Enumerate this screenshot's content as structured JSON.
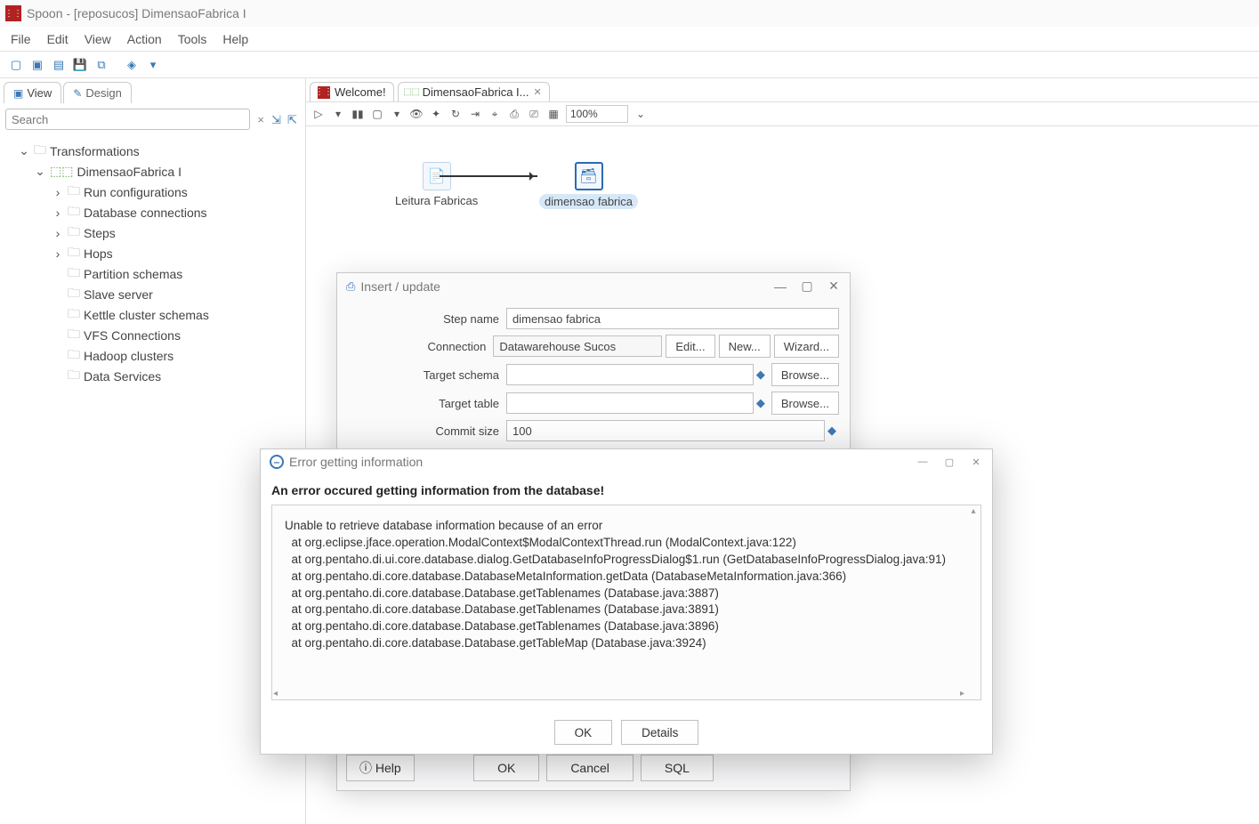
{
  "window": {
    "title": "Spoon - [reposucos] DimensaoFabrica I"
  },
  "menu": [
    "File",
    "Edit",
    "View",
    "Action",
    "Tools",
    "Help"
  ],
  "left": {
    "tabs": {
      "view": "View",
      "design": "Design"
    },
    "search_ph": "Search",
    "tree": {
      "root": "Transformations",
      "trans": "DimensaoFabrica I",
      "items": [
        "Run configurations",
        "Database connections",
        "Steps",
        "Hops",
        "Partition schemas",
        "Slave server",
        "Kettle cluster schemas",
        "VFS Connections",
        "Hadoop clusters",
        "Data Services"
      ]
    }
  },
  "editor": {
    "tabs": {
      "welcome": "Welcome!",
      "trans": "DimensaoFabrica I..."
    },
    "zoom": "100%",
    "nodes": {
      "leitura": "Leitura Fabricas",
      "dimensao": "dimensao fabrica"
    }
  },
  "insert_dialog": {
    "title": "Insert / update",
    "labels": {
      "step": "Step name",
      "conn": "Connection",
      "schema": "Target schema",
      "table": "Target table",
      "commit": "Commit size"
    },
    "values": {
      "step": "dimensao fabrica",
      "conn": "Datawarehouse Sucos",
      "schema": "",
      "table": "",
      "commit": "100"
    },
    "buttons": {
      "edit": "Edit...",
      "new": "New...",
      "wizard": "Wizard...",
      "browse": "Browse...",
      "help": "Help",
      "ok": "OK",
      "cancel": "Cancel",
      "sql": "SQL"
    }
  },
  "error_dialog": {
    "title": "Error getting information",
    "heading": "An error occured getting information from the database!",
    "stack": "Unable to retrieve database information because of an error\n  at org.eclipse.jface.operation.ModalContext$ModalContextThread.run (ModalContext.java:122)\n  at org.pentaho.di.ui.core.database.dialog.GetDatabaseInfoProgressDialog$1.run (GetDatabaseInfoProgressDialog.java:91)\n  at org.pentaho.di.core.database.DatabaseMetaInformation.getData (DatabaseMetaInformation.java:366)\n  at org.pentaho.di.core.database.Database.getTablenames (Database.java:3887)\n  at org.pentaho.di.core.database.Database.getTablenames (Database.java:3891)\n  at org.pentaho.di.core.database.Database.getTablenames (Database.java:3896)\n  at org.pentaho.di.core.database.Database.getTableMap (Database.java:3924)",
    "buttons": {
      "ok": "OK",
      "details": "Details"
    }
  }
}
